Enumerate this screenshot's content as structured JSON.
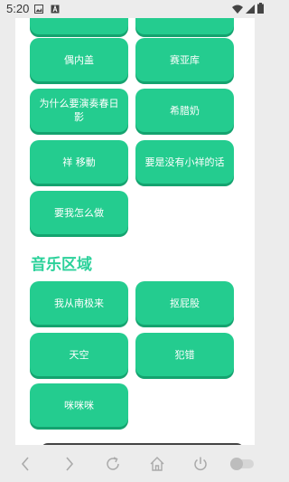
{
  "status_bar": {
    "time": "5:20"
  },
  "buttons_top": [
    {
      "label": ""
    },
    {
      "label": ""
    },
    {
      "label": "偶内盖"
    },
    {
      "label": "赛亚库"
    },
    {
      "label": "为什么要演奏春日影"
    },
    {
      "label": "希腊奶"
    },
    {
      "label": "祥 移動"
    },
    {
      "label": "要是没有小祥的话"
    },
    {
      "label": "要我怎么做"
    }
  ],
  "music_section": {
    "title": "音乐区域",
    "buttons": [
      {
        "label": "我从南极来"
      },
      {
        "label": "抠屁股"
      },
      {
        "label": "天空"
      },
      {
        "label": "犯错"
      },
      {
        "label": "咪咪咪"
      }
    ]
  },
  "colors": {
    "accent": "#24cc8f",
    "title": "#2bd19a"
  }
}
